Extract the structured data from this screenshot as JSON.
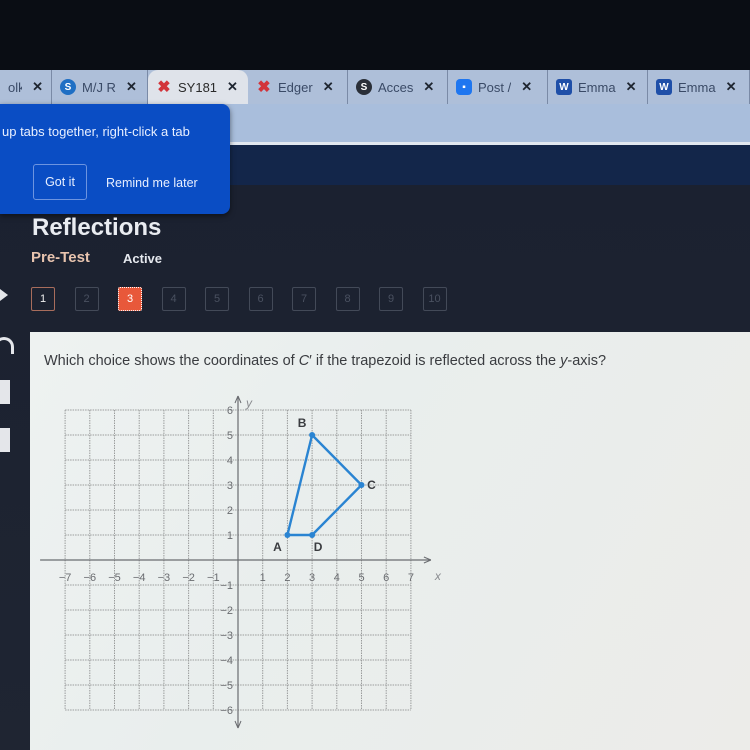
{
  "browser": {
    "tabs": [
      {
        "label": "olk k",
        "icon": "generic-tab-icon",
        "icon_color": "#3a4a66"
      },
      {
        "label": "M/J R",
        "icon": "s-circle-icon",
        "icon_color": "#1f6fc4"
      },
      {
        "label": "SY181",
        "icon": "edgenuity-x-icon",
        "icon_color": "#d2343a",
        "active": true
      },
      {
        "label": "Edger",
        "icon": "edgenuity-x-icon",
        "icon_color": "#d2343a"
      },
      {
        "label": "Acces",
        "icon": "sharepoint-icon",
        "icon_color": "#2a2f38"
      },
      {
        "label": "Post /",
        "icon": "zoom-camera-icon",
        "icon_color": "#1e76f0"
      },
      {
        "label": "Emma",
        "icon": "word-icon",
        "icon_color": "#1f4fa8"
      },
      {
        "label": "Emma",
        "icon": "word-icon",
        "icon_color": "#1f4fa8"
      }
    ],
    "close_glyph": "✕"
  },
  "popup": {
    "text": "up tabs together, right-click a tab",
    "got_it": "Got it",
    "remind": "Remind me later",
    "bg_color": "#0a4dc4"
  },
  "header": {
    "title": "Reflections",
    "subtitle": "Pre-Test",
    "status": "Active"
  },
  "question_nav": {
    "items": [
      "1",
      "2",
      "3",
      "4",
      "5",
      "6",
      "7",
      "8",
      "9",
      "10"
    ],
    "current": 3,
    "visited": [
      1
    ],
    "current_color": "#e8583a"
  },
  "question": {
    "prefix": "Which choice shows the coordinates of ",
    "var": "C",
    "middle": "′ if the trapezoid is reflected across the ",
    "axis_var": "y",
    "suffix": "-axis?"
  },
  "chart_data": {
    "type": "scatter",
    "title": "",
    "xlabel": "x",
    "ylabel": "y",
    "xlim": [
      -7,
      7
    ],
    "ylim": [
      -6,
      6
    ],
    "x_ticks": [
      -7,
      -6,
      -5,
      -4,
      -3,
      -2,
      -1,
      1,
      2,
      3,
      4,
      5,
      6,
      7
    ],
    "y_ticks": [
      6,
      5,
      4,
      3,
      2,
      1,
      -1,
      -2,
      -3,
      -4,
      -5,
      -6
    ],
    "grid": true,
    "shape": "trapezoid",
    "points": [
      {
        "label": "A",
        "x": 2,
        "y": 1
      },
      {
        "label": "B",
        "x": 3,
        "y": 5
      },
      {
        "label": "C",
        "x": 5,
        "y": 3
      },
      {
        "label": "D",
        "x": 3,
        "y": 1
      }
    ],
    "polygon_order": [
      "A",
      "B",
      "C",
      "D"
    ],
    "line_color": "#2a84d2"
  }
}
